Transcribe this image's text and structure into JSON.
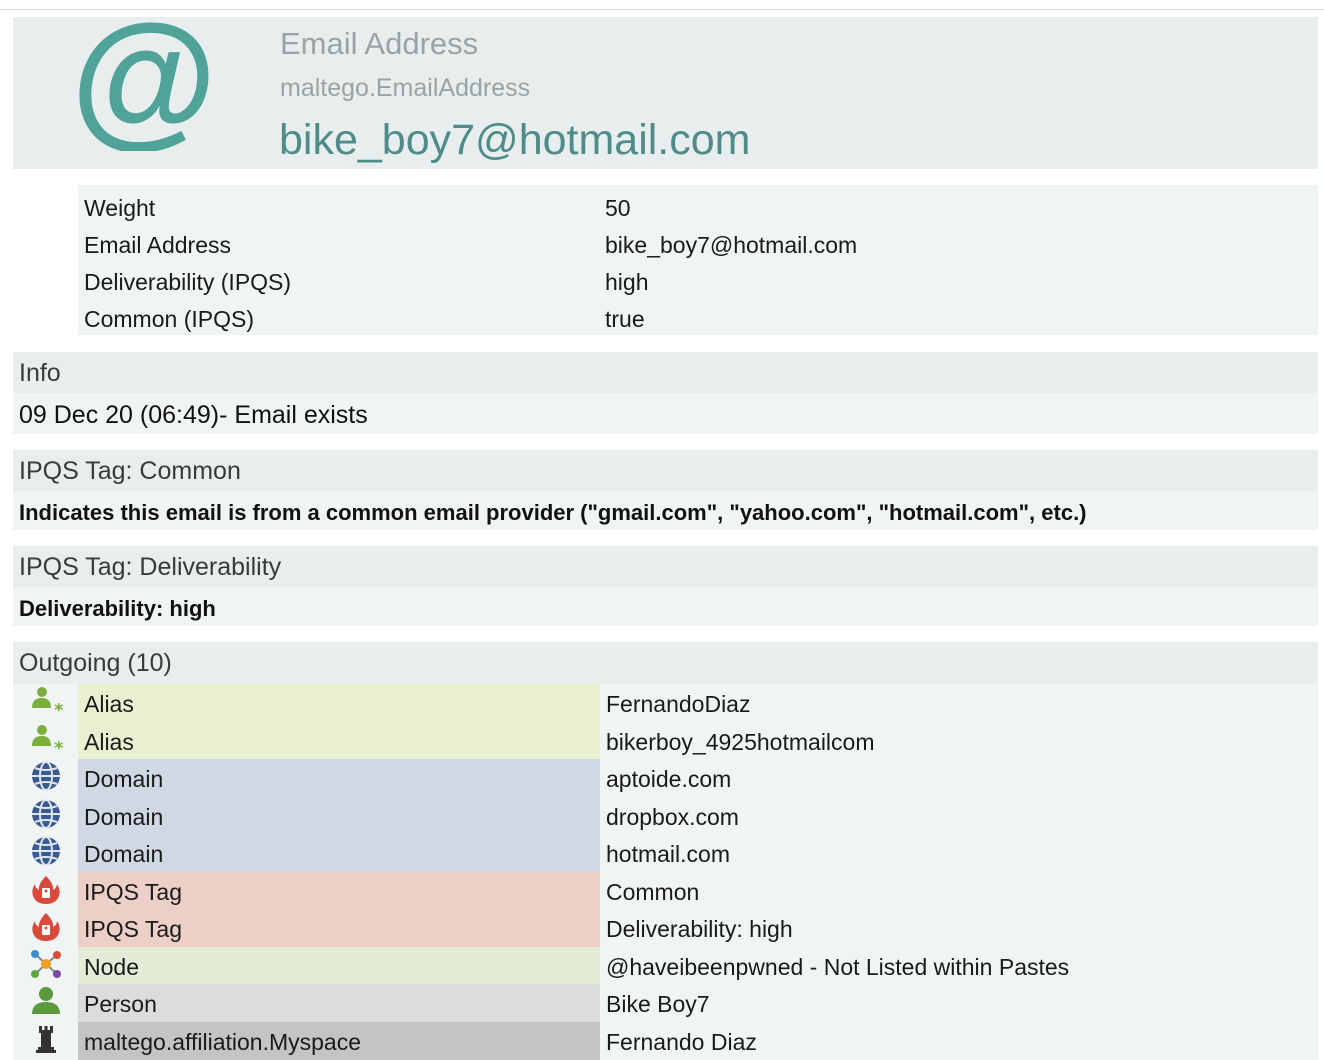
{
  "entity": {
    "type_label": "Email Address",
    "class_name": "maltego.EmailAddress",
    "value": "bike_boy7@hotmail.com",
    "icon": "at-sign-icon"
  },
  "properties": [
    {
      "key": "Weight",
      "value": "50"
    },
    {
      "key": "Email Address",
      "value": "bike_boy7@hotmail.com"
    },
    {
      "key": "Deliverability (IPQS)",
      "value": "high"
    },
    {
      "key": "Common (IPQS)",
      "value": "true"
    }
  ],
  "sections": {
    "info": {
      "title": "Info",
      "text": "09 Dec 20 (06:49)- Email exists"
    },
    "tag_common": {
      "title": "IPQS Tag: Common",
      "text": "Indicates this email is from a common email provider (\"gmail.com\", \"yahoo.com\", \"hotmail.com\", etc.)"
    },
    "tag_deliverability": {
      "title": "IPQS Tag: Deliverability",
      "text": "Deliverability: high"
    }
  },
  "outgoing": {
    "title": "Outgoing (10)",
    "rows": [
      {
        "type": "Alias",
        "value": "FernandoDiaz",
        "icon": "alias-person-icon",
        "color": "#e8f0d0"
      },
      {
        "type": "Alias",
        "value": "bikerboy_4925hotmailcom",
        "icon": "alias-person-icon",
        "color": "#e8f0d0"
      },
      {
        "type": "Domain",
        "value": "aptoide.com",
        "icon": "globe-icon",
        "color": "#d0d8e4"
      },
      {
        "type": "Domain",
        "value": "dropbox.com",
        "icon": "globe-icon",
        "color": "#d0d8e4"
      },
      {
        "type": "Domain",
        "value": "hotmail.com",
        "icon": "globe-icon",
        "color": "#d0d8e4"
      },
      {
        "type": "IPQS Tag",
        "value": "Common",
        "icon": "fire-tag-icon",
        "color": "#ecd0c8"
      },
      {
        "type": "IPQS Tag",
        "value": "Deliverability: high",
        "icon": "fire-tag-icon",
        "color": "#ecd0c8"
      },
      {
        "type": "Node",
        "value": "@haveibeenpwned - Not Listed within Pastes",
        "icon": "node-graph-icon",
        "color": "#e4ecd8"
      },
      {
        "type": "Person",
        "value": "Bike Boy7",
        "icon": "person-icon",
        "color": "#dcdcdc"
      },
      {
        "type": "maltego.affiliation.Myspace",
        "value": "Fernando Diaz",
        "icon": "myspace-tower-icon",
        "color": "#c4c4c4"
      }
    ]
  }
}
